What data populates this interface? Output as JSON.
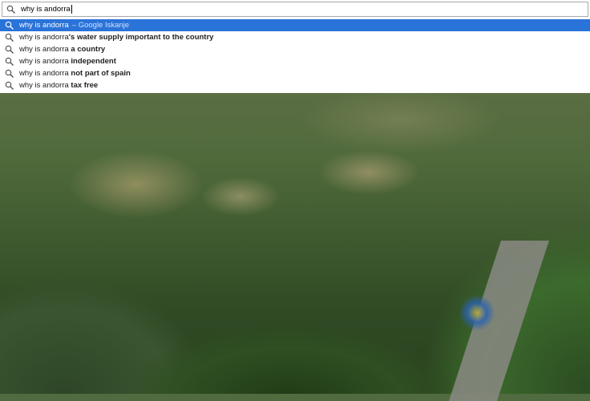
{
  "search": {
    "query": "why is andorra"
  },
  "suggestions": [
    {
      "typed": "why is andorra",
      "rest": "",
      "note": "– Google Iskanje"
    },
    {
      "typed": "why is andorra",
      "rest": "'s water supply important to the country",
      "note": ""
    },
    {
      "typed": "why is andorra",
      "rest": " a country",
      "note": ""
    },
    {
      "typed": "why is andorra",
      "rest": " independent",
      "note": ""
    },
    {
      "typed": "why is andorra",
      "rest": " not part of spain",
      "note": ""
    },
    {
      "typed": "why is andorra",
      "rest": " tax free",
      "note": ""
    }
  ],
  "icons": {
    "search": "search-icon"
  },
  "colors": {
    "highlight": "#2a73d8",
    "text": "#222222"
  }
}
